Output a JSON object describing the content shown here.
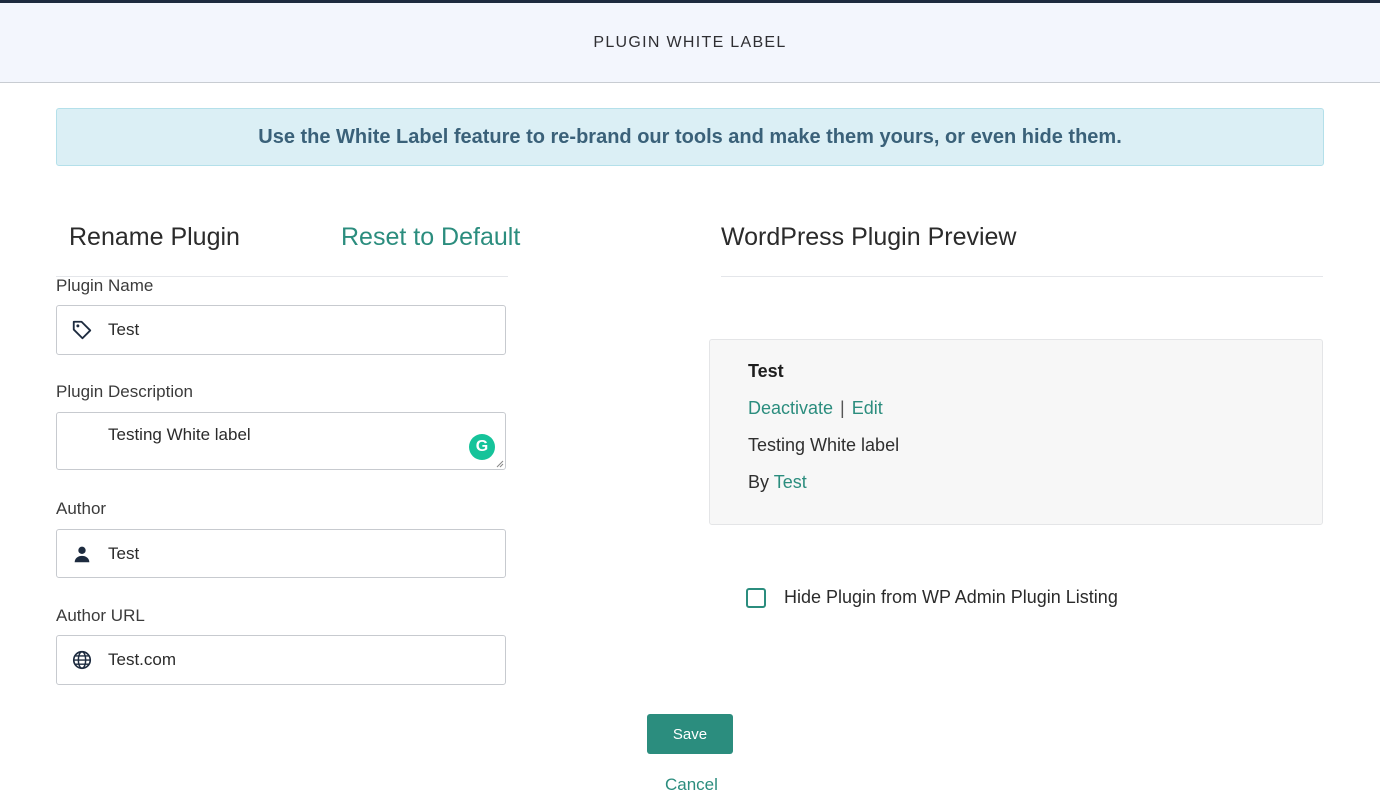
{
  "header": {
    "title": "PLUGIN WHITE LABEL"
  },
  "notice": {
    "text": "Use the White Label feature to re-brand our tools and make them yours, or even hide them."
  },
  "rename": {
    "title": "Rename Plugin",
    "reset_label": "Reset to Default",
    "fields": {
      "plugin_name": {
        "label": "Plugin Name",
        "value": "Test",
        "icon": "tag-icon"
      },
      "plugin_description": {
        "label": "Plugin Description",
        "value": "Testing White label",
        "extension_badge": "G"
      },
      "author": {
        "label": "Author",
        "value": "Test",
        "icon": "user-icon"
      },
      "author_url": {
        "label": "Author URL",
        "value": "Test.com",
        "icon": "globe-icon"
      }
    }
  },
  "preview": {
    "title": "WordPress Plugin Preview",
    "plugin_name": "Test",
    "deactivate_label": "Deactivate",
    "separator": "|",
    "edit_label": "Edit",
    "description": "Testing White label",
    "by_label": "By",
    "author": "Test"
  },
  "options": {
    "hide_plugin_label": "Hide Plugin from WP Admin Plugin Listing",
    "hide_plugin_checked": false
  },
  "actions": {
    "save_label": "Save",
    "cancel_label": "Cancel"
  },
  "colors": {
    "accent": "#2b8d7e",
    "header_bg": "#f3f6fd",
    "notice_bg": "#dbeff5",
    "notice_text": "#3a6179",
    "top_border": "#1d2b3f"
  }
}
